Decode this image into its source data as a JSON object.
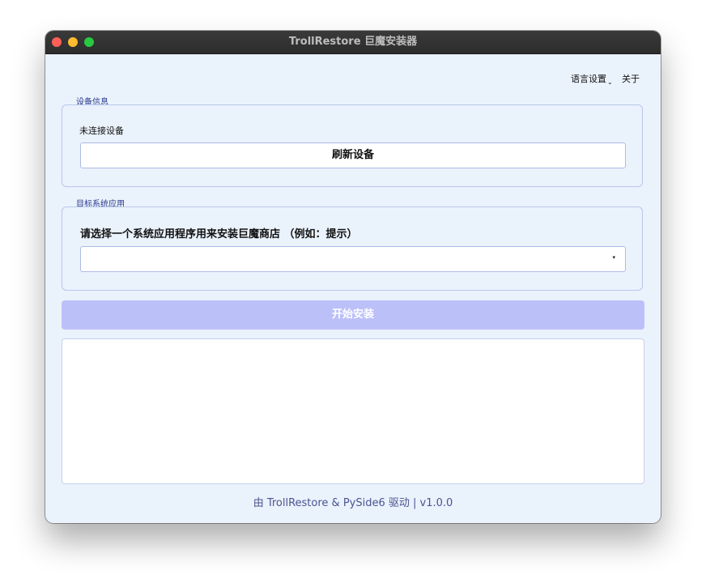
{
  "window": {
    "title": "TrollRestore 巨魔安装器"
  },
  "menu": {
    "language": "语言设置",
    "about": "关于"
  },
  "device_group": {
    "title": "设备信息",
    "status": "未连接设备",
    "refresh_label": "刷新设备"
  },
  "target_group": {
    "title": "目标系统应用",
    "prompt": "请选择一个系统应用程序用来安装巨魔商店 （例如：提示）",
    "selected_value": ""
  },
  "install_label": "开始安装",
  "log_text": "",
  "footer": "由 TrollRestore & PySide6 驱动 | v1.0.0",
  "colors": {
    "accent": "#bcc0f9",
    "group_border": "#b9c7ea",
    "background": "#eaf2fc",
    "group_title": "#2b3a8c"
  },
  "icons": {
    "language_menu": "chevron-down-icon",
    "select_arrow": "triangle-down-icon"
  }
}
